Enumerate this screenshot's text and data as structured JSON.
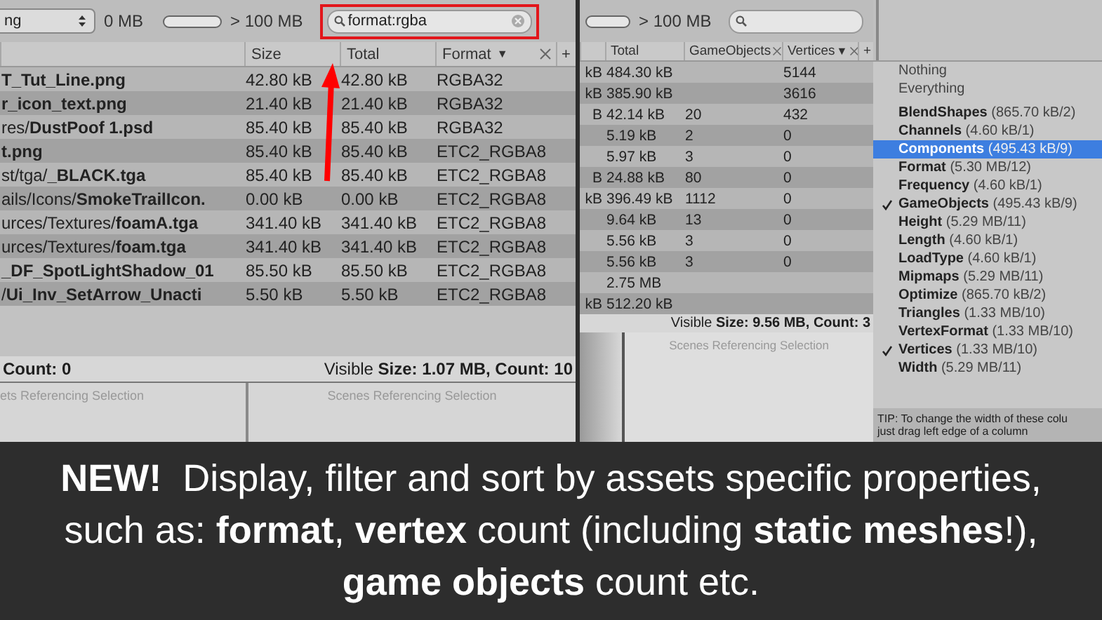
{
  "left_panel": {
    "type_dropdown": "ng",
    "size_min": "0 MB",
    "size_slider": {
      "level": 1
    },
    "size_max": "> 100 MB",
    "search": {
      "value": "format:rgba",
      "highlighted": true
    },
    "columns": [
      {
        "label": "Size",
        "closable": false
      },
      {
        "label": "Total",
        "closable": false
      },
      {
        "label": "Format",
        "sort": "▼",
        "closable": true
      }
    ],
    "add_column": "+",
    "rows": [
      {
        "file": "T_Tut_Line.png",
        "size": "42.80 kB",
        "total": "42.80 kB",
        "format": "RGBA32"
      },
      {
        "file": "r_icon_text.png",
        "size": "21.40 kB",
        "total": "21.40 kB",
        "format": "RGBA32"
      },
      {
        "dir": "res/",
        "file": "DustPoof 1.psd",
        "size": "85.40 kB",
        "total": "85.40 kB",
        "format": "RGBA32"
      },
      {
        "file": "t.png",
        "size": "85.40 kB",
        "total": "85.40 kB",
        "format": "ETC2_RGBA8"
      },
      {
        "dir": "st/tga/",
        "file": "_BLACK.tga",
        "size": "85.40 kB",
        "total": "85.40 kB",
        "format": "ETC2_RGBA8"
      },
      {
        "dir": "ails/Icons/",
        "file": "SmokeTrailIcon.",
        "size": "0.00 kB",
        "total": "0.00 kB",
        "format": "ETC2_RGBA8"
      },
      {
        "dir": "urces/Textures/",
        "file": "foamA.tga",
        "size": "341.40 kB",
        "total": "341.40 kB",
        "format": "ETC2_RGBA8"
      },
      {
        "dir": "urces/Textures/",
        "file": "foam.tga",
        "size": "341.40 kB",
        "total": "341.40 kB",
        "format": "ETC2_RGBA8"
      },
      {
        "file": "_DF_SpotLightShadow_01",
        "size": "85.50 kB",
        "total": "85.50 kB",
        "format": "ETC2_RGBA8"
      },
      {
        "dir": "/",
        "file": "Ui_Inv_SetArrow_Unacti",
        "size": "5.50 kB",
        "total": "5.50 kB",
        "format": "ETC2_RGBA8"
      }
    ],
    "status_left": "Count: 0",
    "status_right": "Visible **Size: 1.07 MB, Count: 10**",
    "references": [
      "ets Referencing Selection",
      "Scenes Referencing Selection"
    ]
  },
  "right_panel": {
    "size_slider": {
      "level": 1
    },
    "size_max": "> 100 MB",
    "columns": [
      {
        "label": "Total",
        "closable": false
      },
      {
        "label": "GameObjects",
        "closable": true
      },
      {
        "label": "Vertices",
        "sort": "▼",
        "closable": true
      }
    ],
    "add_column": "+",
    "rows": [
      {
        "column_1": "kB",
        "total": "484.30 kB",
        "vertices": "5144"
      },
      {
        "column_1": "kB",
        "total": "385.90 kB",
        "vertices": "3616"
      },
      {
        "column_1": "B",
        "total": "42.14 kB",
        "gameobjects": "20",
        "vertices": "432"
      },
      {
        "total": "5.19 kB",
        "gameobjects": "2",
        "vertices": "0"
      },
      {
        "total": "5.97 kB",
        "gameobjects": "3",
        "vertices": "0"
      },
      {
        "column_1": "B",
        "total": "24.88 kB",
        "gameobjects": "80",
        "vertices": "0"
      },
      {
        "column_1": "kB",
        "total": "396.49 kB",
        "gameobjects": "1112",
        "vertices": "0"
      },
      {
        "total": "9.64 kB",
        "gameobjects": "13",
        "vertices": "0"
      },
      {
        "total": "5.56 kB",
        "gameobjects": "3",
        "vertices": "0"
      },
      {
        "total": "5.56 kB",
        "gameobjects": "3",
        "vertices": "0"
      },
      {
        "total": "2.75 MB"
      },
      {
        "column_1": "kB",
        "total": "512.20 kB"
      }
    ],
    "status_right": "Visible **Size: 9.56 MB, Count: 3**",
    "references": [
      "Scenes Referencing Selection"
    ]
  },
  "column_menu": {
    "presets": [
      "Nothing",
      "Everything"
    ],
    "items": [
      {
        "name": "BlendShapes",
        "detail": "(865.70 kB/2)",
        "checked": false,
        "selected": false
      },
      {
        "name": "Channels",
        "detail": "(4.60 kB/1)",
        "checked": false,
        "selected": false
      },
      {
        "name": "Components",
        "detail": "(495.43 kB/9)",
        "checked": false,
        "selected": true
      },
      {
        "name": "Format",
        "detail": "(5.30 MB/12)",
        "checked": false,
        "selected": false
      },
      {
        "name": "Frequency",
        "detail": "(4.60 kB/1)",
        "checked": false,
        "selected": false
      },
      {
        "name": "GameObjects",
        "detail": "(495.43 kB/9)",
        "checked": true,
        "selected": false
      },
      {
        "name": "Height",
        "detail": "(5.29 MB/11)",
        "checked": false,
        "selected": false
      },
      {
        "name": "Length",
        "detail": "(4.60 kB/1)",
        "checked": false,
        "selected": false
      },
      {
        "name": "LoadType",
        "detail": "(4.60 kB/1)",
        "checked": false,
        "selected": false
      },
      {
        "name": "Mipmaps",
        "detail": "(5.29 MB/11)",
        "checked": false,
        "selected": false
      },
      {
        "name": "Optimize",
        "detail": "(865.70 kB/2)",
        "checked": false,
        "selected": false
      },
      {
        "name": "Triangles",
        "detail": "(1.33 MB/10)",
        "checked": false,
        "selected": false
      },
      {
        "name": "VertexFormat",
        "detail": "(1.33 MB/10)",
        "checked": false,
        "selected": false
      },
      {
        "name": "Vertices",
        "detail": "(1.33 MB/10)",
        "checked": true,
        "selected": false
      },
      {
        "name": "Width",
        "detail": "(5.29 MB/11)",
        "checked": false,
        "selected": false
      }
    ],
    "tip": [
      "TIP: To change the width of these colu",
      "just drag left edge of a column"
    ]
  },
  "caption": "**NEW!**  Display, filter and sort by assets specific properties, such as: **format**, **vertex** count (including **static meshes**!), **game objects** count etc."
}
